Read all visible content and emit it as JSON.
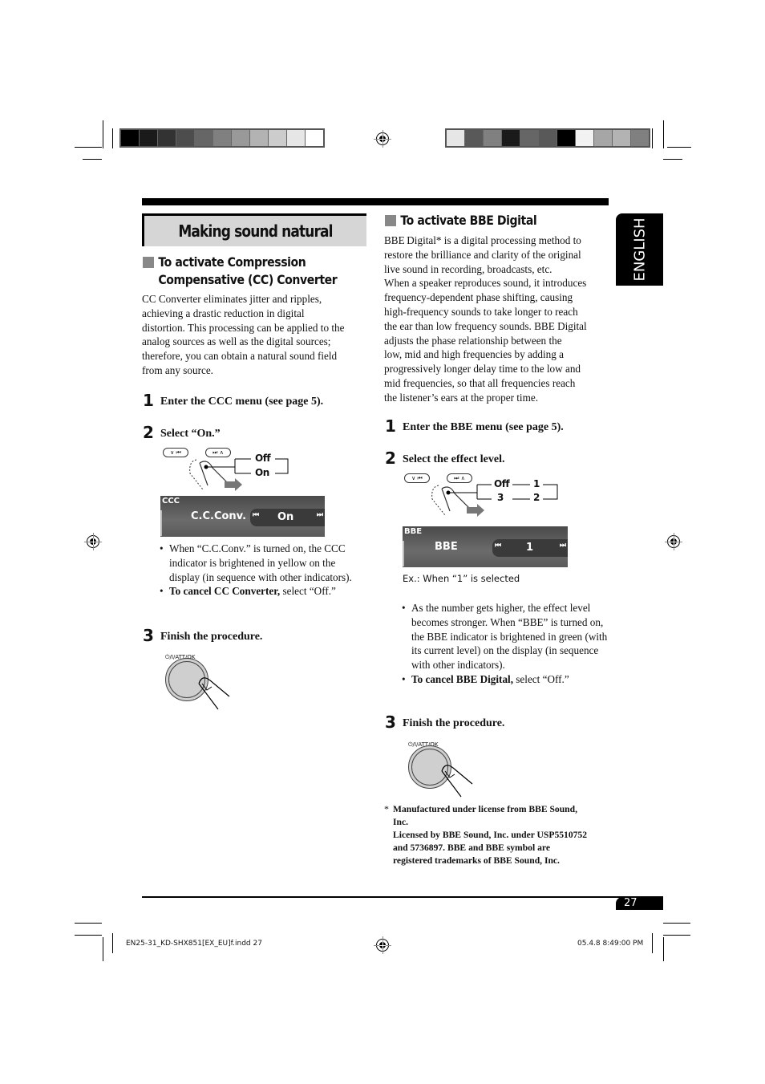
{
  "print_marks": {
    "left_swatches": [
      "#000000",
      "#1a1a1a",
      "#333333",
      "#4d4d4d",
      "#666666",
      "#808080",
      "#999999",
      "#b3b3b3",
      "#cccccc",
      "#e6e6e6",
      "#ffffff"
    ],
    "right_swatches": [
      "#e6e6e6",
      "#595959",
      "#808080",
      "#1a1a1a",
      "#666666",
      "#595959",
      "#000000",
      "#f2f2f2",
      "#a6a6a6",
      "#b3b3b3",
      "#808080"
    ],
    "slug_left": "EN25-31_KD-SHX851[EX_EU]f.indd   27",
    "slug_right": "05.4.8   8:49:00 PM"
  },
  "page": {
    "title": "Making sound natural",
    "language_tab": "ENGLISH",
    "page_number": "27"
  },
  "cc_section": {
    "heading_line1": "To activate Compression",
    "heading_line2": "Compensative (CC) Converter",
    "intro": [
      "CC Converter eliminates jitter and ripples,",
      "achieving a drastic reduction in digital",
      "distortion. This processing can be applied to the",
      "analog sources as well as the digital sources;",
      "therefore, you can obtain a natural sound field",
      "from any source."
    ],
    "steps": [
      {
        "num": "1",
        "label": "Enter the CCC menu (see page 5)."
      },
      {
        "num": "2",
        "label": "Select “On.”"
      },
      {
        "num": "3",
        "label": "Finish the procedure."
      }
    ],
    "buttons": {
      "down": "∨ ⏮",
      "up": "⏭ ∧"
    },
    "sequence": [
      "Off",
      "On"
    ],
    "display": {
      "tag": "CCC",
      "item": "C.C.Conv.",
      "value": "On",
      "prev": "⏮",
      "next": "⏭"
    },
    "bullets": [
      {
        "bold": "",
        "text": "When “C.C.Conv.” is turned on, the CCC indicator is brightened in yellow on the display (in sequence with other indicators)."
      },
      {
        "bold": "To cancel CC Converter,",
        "text": " select “Off.”"
      }
    ],
    "knob_label": "⏻/I/ATT/OK"
  },
  "bbe_section": {
    "heading": "To activate BBE Digital",
    "intro": [
      "BBE Digital* is a digital processing method to",
      "restore the brilliance and clarity of the original",
      "live sound in recording, broadcasts, etc.",
      "When a speaker reproduces sound, it introduces",
      "frequency-dependent phase shifting, causing",
      "high-frequency sounds to take longer to reach",
      "the ear than low frequency sounds. BBE Digital",
      "adjusts the phase relationship between the",
      "low, mid and high frequencies by adding a",
      "progressively longer delay time to the low and",
      "mid frequencies, so that all frequencies reach",
      "the listener’s ears at the proper time."
    ],
    "steps": [
      {
        "num": "1",
        "label": "Enter the BBE menu (see page 5)."
      },
      {
        "num": "2",
        "label": "Select the effect level."
      },
      {
        "num": "3",
        "label": "Finish the procedure."
      }
    ],
    "buttons": {
      "down": "∨ ⏮",
      "up": "⏭ ∧"
    },
    "sequence": [
      "Off",
      "1",
      "3",
      "2"
    ],
    "display": {
      "tag": "BBE",
      "item": "BBE",
      "value": "1",
      "prev": "⏮",
      "next": "⏭"
    },
    "caption": "Ex.: When “1” is selected",
    "bullets": [
      {
        "bold": "",
        "text": "As the number gets higher, the effect level becomes stronger. When “BBE” is turned on, the BBE indicator is brightened in green (with its current level) on the display (in sequence with other indicators)."
      },
      {
        "bold": "To cancel BBE Digital,",
        "text": " select “Off.”"
      }
    ],
    "knob_label": "⏻/I/ATT/OK",
    "footnote": {
      "marker": "*",
      "lines": [
        "Manufactured under license from BBE Sound,",
        "Inc.",
        "Licensed by BBE Sound, Inc. under USP5510752",
        "and 5736897. BBE and BBE symbol are",
        "registered trademarks of BBE Sound, Inc."
      ]
    }
  }
}
